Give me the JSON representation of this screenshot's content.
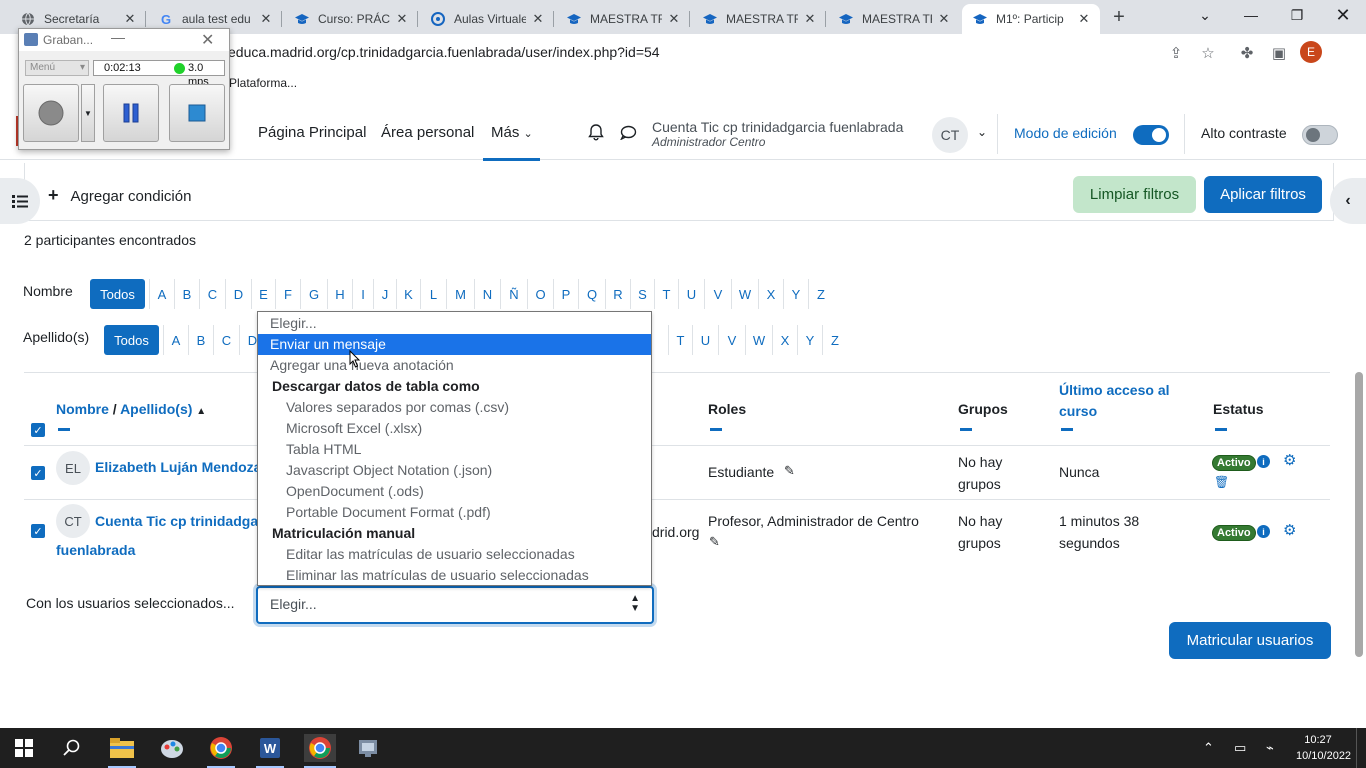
{
  "browser": {
    "tabs": [
      {
        "title": "Secretaría",
        "icon": "globe-icon"
      },
      {
        "title": "aula test edu",
        "icon": "google-icon"
      },
      {
        "title": "Curso: PRÁCT",
        "icon": "moodle-cap-icon"
      },
      {
        "title": "Aulas Virtuale",
        "icon": "aulas-virtuales-icon"
      },
      {
        "title": "MAESTRA TR",
        "icon": "moodle-cap-icon"
      },
      {
        "title": "MAESTRA TR",
        "icon": "moodle-cap-icon"
      },
      {
        "title": "MAESTRA TR",
        "icon": "moodle-cap-icon"
      },
      {
        "title": "M1º: Particip",
        "icon": "moodle-cap-icon",
        "active": true
      }
    ],
    "url": "educa.madrid.org/cp.trinidadgarcia.fuenlabrada/user/index.php?id=54",
    "bookmark": "Plataforma...",
    "profile_initial": "E"
  },
  "recorder": {
    "title": "Graban...",
    "menu": "Menú",
    "time": "0:02:13",
    "fps": "3.0 mps"
  },
  "navbar": {
    "links": [
      "Página Principal",
      "Área personal",
      "Más"
    ],
    "user_name": "Cuenta Tic cp trinidadgarcia fuenlabrada",
    "user_role": "Administrador Centro",
    "user_initials": "CT",
    "edit_mode_label": "Modo de edición",
    "edit_mode_on": true,
    "high_contrast_label": "Alto contraste",
    "high_contrast_on": false
  },
  "filters": {
    "add_condition": "Agregar condición",
    "clear": "Limpiar filtros",
    "apply": "Aplicar filtros"
  },
  "participants_found": "2 participantes encontrados",
  "initials_bar": {
    "first_name_label": "Nombre",
    "last_name_label": "Apellido(s)",
    "all_label": "Todos",
    "letters": [
      "A",
      "B",
      "C",
      "D",
      "E",
      "F",
      "G",
      "H",
      "I",
      "J",
      "K",
      "L",
      "M",
      "N",
      "Ñ",
      "O",
      "P",
      "Q",
      "R",
      "S",
      "T",
      "U",
      "V",
      "W",
      "X",
      "Y",
      "Z"
    ]
  },
  "table": {
    "headers": {
      "name": "Nombre",
      "name_sep": "/",
      "surname": "Apellido(s)",
      "roles": "Roles",
      "groups": "Grupos",
      "last_access": "Último acceso al curso",
      "status": "Estatus"
    },
    "rows": [
      {
        "initials": "EL",
        "name": "Elizabeth Luján Mendoza",
        "email_fragment": "",
        "roles": "Estudiante",
        "groups": "No hay grupos",
        "last_access": "Nunca",
        "status": "Activo"
      },
      {
        "initials": "CT",
        "name": "Cuenta Tic cp trinidadga",
        "name_line2": "fuenlabrada",
        "email_fragment": "drid.org",
        "roles": "Profesor, Administrador de Centro",
        "groups": "No hay grupos",
        "last_access": "1 minutos 38 segundos",
        "status": "Activo"
      }
    ]
  },
  "bulk": {
    "label": "Con los usuarios seleccionados...",
    "selected_value": "Elegir...",
    "options": [
      {
        "label": "Elegir...",
        "kind": "option"
      },
      {
        "label": "Enviar un mensaje",
        "kind": "option",
        "highlighted": true
      },
      {
        "label": "Agregar una nueva anotación",
        "kind": "option"
      },
      {
        "label": "Descargar datos de tabla como",
        "kind": "group"
      },
      {
        "label": "Valores separados por comas (.csv)",
        "kind": "sub"
      },
      {
        "label": "Microsoft Excel (.xlsx)",
        "kind": "sub"
      },
      {
        "label": "Tabla HTML",
        "kind": "sub"
      },
      {
        "label": "Javascript Object Notation (.json)",
        "kind": "sub"
      },
      {
        "label": "OpenDocument (.ods)",
        "kind": "sub"
      },
      {
        "label": "Portable Document Format (.pdf)",
        "kind": "sub"
      },
      {
        "label": "Matriculación manual",
        "kind": "group"
      },
      {
        "label": "Editar las matrículas de usuario seleccionadas",
        "kind": "sub"
      },
      {
        "label": "Eliminar las matrículas de usuario seleccionadas",
        "kind": "sub"
      }
    ]
  },
  "enrol_button": "Matricular usuarios",
  "taskbar": {
    "time": "10:27",
    "date": "10/10/2022"
  }
}
